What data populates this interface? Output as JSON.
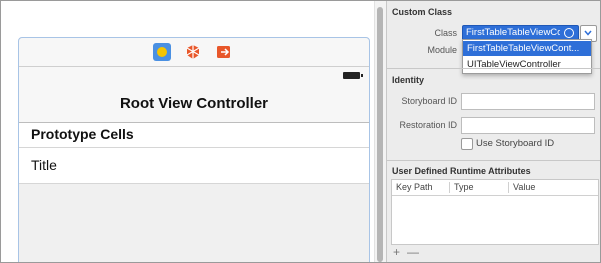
{
  "canvas": {
    "navigation_title": "Root View Controller",
    "section_header": "Prototype Cells",
    "cell_title": "Title",
    "dock_icons": [
      "view-controller-icon",
      "first-responder-icon",
      "exit-icon"
    ]
  },
  "inspector": {
    "custom_class": {
      "title": "Custom Class",
      "class_label": "Class",
      "class_value": "FirstTableTableViewCo",
      "module_label": "Module",
      "suggestions": [
        "FirstTableTableViewCont...",
        "UITableViewController"
      ]
    },
    "identity": {
      "title": "Identity",
      "storyboard_id_label": "Storyboard ID",
      "storyboard_id_value": "",
      "restoration_id_label": "Restoration ID",
      "restoration_id_value": "",
      "use_storyboard_id_label": "Use Storyboard ID",
      "use_storyboard_id_checked": false
    },
    "runtime_attributes": {
      "title": "User Defined Runtime Attributes",
      "columns": [
        "Key Path",
        "Type",
        "Value"
      ],
      "add_symbol": "+",
      "remove_symbol": "—"
    }
  },
  "colors": {
    "selection_blue": "#2e6fd8",
    "view_controller_icon": "#4a90e2",
    "accent_orange": "#e8572a"
  }
}
